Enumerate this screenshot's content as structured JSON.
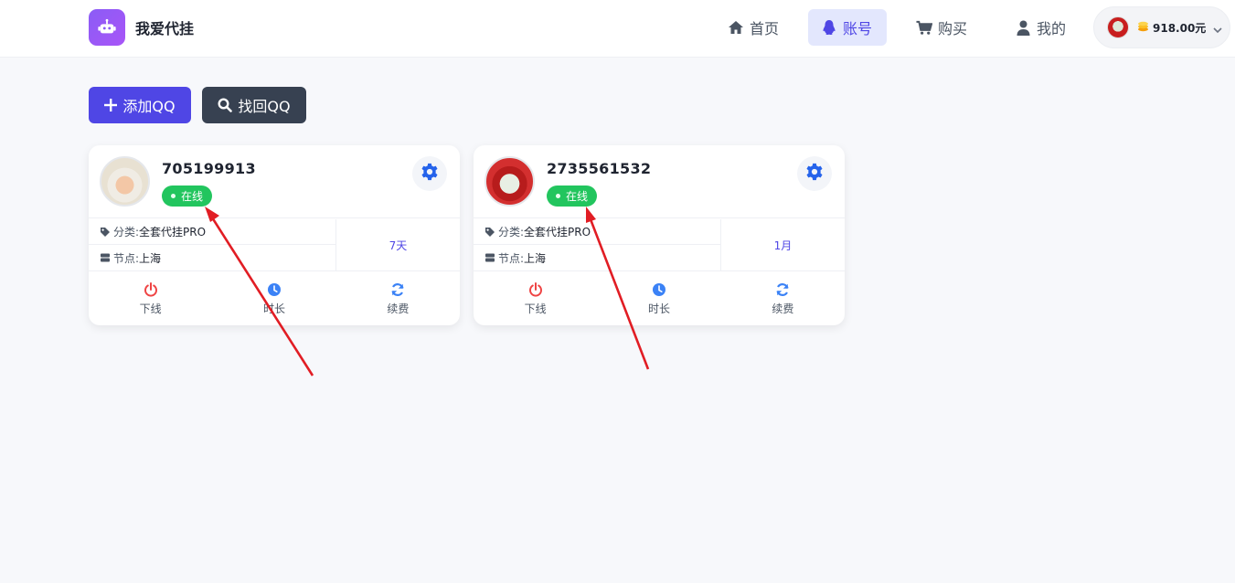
{
  "brand": {
    "name": "我爱代挂"
  },
  "nav": [
    {
      "label": "首页",
      "icon": "home-icon"
    },
    {
      "label": "账号",
      "icon": "qq-penguin-icon",
      "active": true
    },
    {
      "label": "购买",
      "icon": "cart-icon"
    },
    {
      "label": "我的",
      "icon": "user-icon"
    }
  ],
  "user": {
    "balance": "918.00元",
    "icon": "coin-icon"
  },
  "actions": {
    "add_label": "添加QQ",
    "find_label": "找回QQ"
  },
  "labels": {
    "category": "分类:",
    "node": "节点:",
    "offline": "下线",
    "duration": "时长",
    "renew": "续费"
  },
  "accounts": [
    {
      "qq": "705199913",
      "status": "在线",
      "category": "全套代挂PRO",
      "node": "上海",
      "duration": "7天"
    },
    {
      "qq": "2735561532",
      "status": "在线",
      "category": "全套代挂PRO",
      "node": "上海",
      "duration": "1月"
    }
  ],
  "colors": {
    "accent": "#4f46e5",
    "online": "#22c55e",
    "offline_icon": "#ef4444",
    "info_icon": "#3b82f6",
    "arrow": "#e11d24"
  }
}
